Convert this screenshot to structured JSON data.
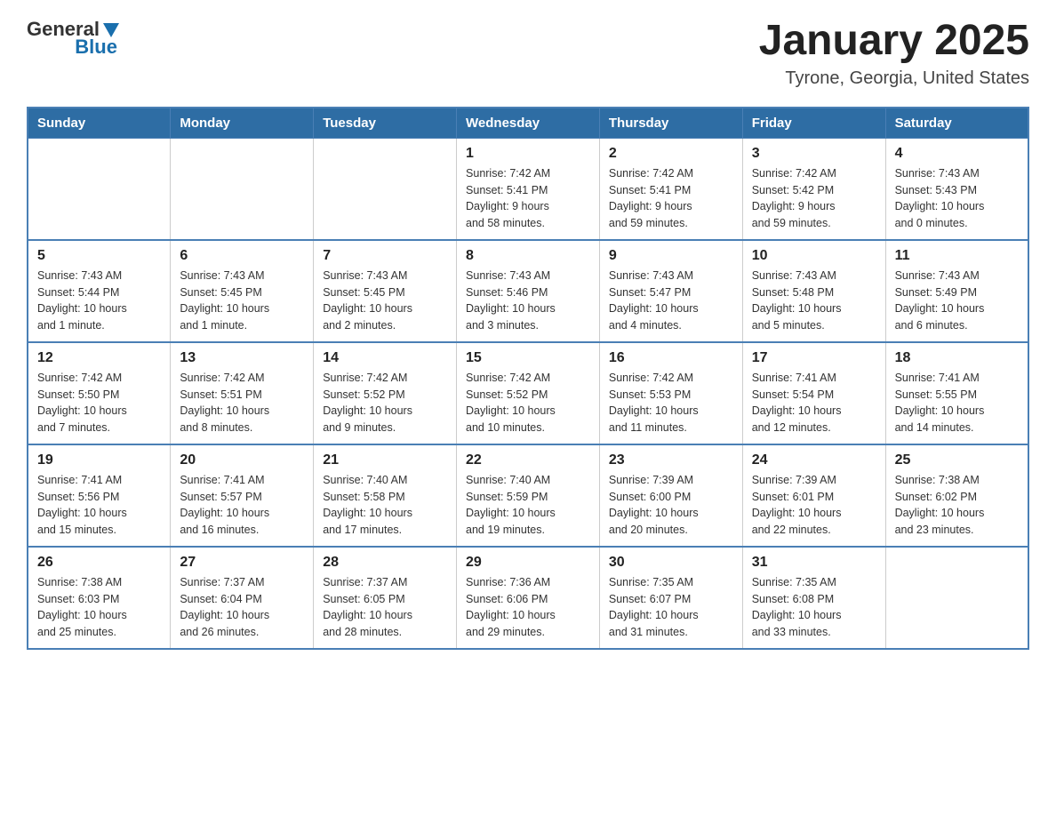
{
  "header": {
    "logo_general": "General",
    "logo_blue": "Blue",
    "title": "January 2025",
    "subtitle": "Tyrone, Georgia, United States"
  },
  "calendar": {
    "days_of_week": [
      "Sunday",
      "Monday",
      "Tuesday",
      "Wednesday",
      "Thursday",
      "Friday",
      "Saturday"
    ],
    "weeks": [
      [
        {
          "day": "",
          "info": ""
        },
        {
          "day": "",
          "info": ""
        },
        {
          "day": "",
          "info": ""
        },
        {
          "day": "1",
          "info": "Sunrise: 7:42 AM\nSunset: 5:41 PM\nDaylight: 9 hours\nand 58 minutes."
        },
        {
          "day": "2",
          "info": "Sunrise: 7:42 AM\nSunset: 5:41 PM\nDaylight: 9 hours\nand 59 minutes."
        },
        {
          "day": "3",
          "info": "Sunrise: 7:42 AM\nSunset: 5:42 PM\nDaylight: 9 hours\nand 59 minutes."
        },
        {
          "day": "4",
          "info": "Sunrise: 7:43 AM\nSunset: 5:43 PM\nDaylight: 10 hours\nand 0 minutes."
        }
      ],
      [
        {
          "day": "5",
          "info": "Sunrise: 7:43 AM\nSunset: 5:44 PM\nDaylight: 10 hours\nand 1 minute."
        },
        {
          "day": "6",
          "info": "Sunrise: 7:43 AM\nSunset: 5:45 PM\nDaylight: 10 hours\nand 1 minute."
        },
        {
          "day": "7",
          "info": "Sunrise: 7:43 AM\nSunset: 5:45 PM\nDaylight: 10 hours\nand 2 minutes."
        },
        {
          "day": "8",
          "info": "Sunrise: 7:43 AM\nSunset: 5:46 PM\nDaylight: 10 hours\nand 3 minutes."
        },
        {
          "day": "9",
          "info": "Sunrise: 7:43 AM\nSunset: 5:47 PM\nDaylight: 10 hours\nand 4 minutes."
        },
        {
          "day": "10",
          "info": "Sunrise: 7:43 AM\nSunset: 5:48 PM\nDaylight: 10 hours\nand 5 minutes."
        },
        {
          "day": "11",
          "info": "Sunrise: 7:43 AM\nSunset: 5:49 PM\nDaylight: 10 hours\nand 6 minutes."
        }
      ],
      [
        {
          "day": "12",
          "info": "Sunrise: 7:42 AM\nSunset: 5:50 PM\nDaylight: 10 hours\nand 7 minutes."
        },
        {
          "day": "13",
          "info": "Sunrise: 7:42 AM\nSunset: 5:51 PM\nDaylight: 10 hours\nand 8 minutes."
        },
        {
          "day": "14",
          "info": "Sunrise: 7:42 AM\nSunset: 5:52 PM\nDaylight: 10 hours\nand 9 minutes."
        },
        {
          "day": "15",
          "info": "Sunrise: 7:42 AM\nSunset: 5:52 PM\nDaylight: 10 hours\nand 10 minutes."
        },
        {
          "day": "16",
          "info": "Sunrise: 7:42 AM\nSunset: 5:53 PM\nDaylight: 10 hours\nand 11 minutes."
        },
        {
          "day": "17",
          "info": "Sunrise: 7:41 AM\nSunset: 5:54 PM\nDaylight: 10 hours\nand 12 minutes."
        },
        {
          "day": "18",
          "info": "Sunrise: 7:41 AM\nSunset: 5:55 PM\nDaylight: 10 hours\nand 14 minutes."
        }
      ],
      [
        {
          "day": "19",
          "info": "Sunrise: 7:41 AM\nSunset: 5:56 PM\nDaylight: 10 hours\nand 15 minutes."
        },
        {
          "day": "20",
          "info": "Sunrise: 7:41 AM\nSunset: 5:57 PM\nDaylight: 10 hours\nand 16 minutes."
        },
        {
          "day": "21",
          "info": "Sunrise: 7:40 AM\nSunset: 5:58 PM\nDaylight: 10 hours\nand 17 minutes."
        },
        {
          "day": "22",
          "info": "Sunrise: 7:40 AM\nSunset: 5:59 PM\nDaylight: 10 hours\nand 19 minutes."
        },
        {
          "day": "23",
          "info": "Sunrise: 7:39 AM\nSunset: 6:00 PM\nDaylight: 10 hours\nand 20 minutes."
        },
        {
          "day": "24",
          "info": "Sunrise: 7:39 AM\nSunset: 6:01 PM\nDaylight: 10 hours\nand 22 minutes."
        },
        {
          "day": "25",
          "info": "Sunrise: 7:38 AM\nSunset: 6:02 PM\nDaylight: 10 hours\nand 23 minutes."
        }
      ],
      [
        {
          "day": "26",
          "info": "Sunrise: 7:38 AM\nSunset: 6:03 PM\nDaylight: 10 hours\nand 25 minutes."
        },
        {
          "day": "27",
          "info": "Sunrise: 7:37 AM\nSunset: 6:04 PM\nDaylight: 10 hours\nand 26 minutes."
        },
        {
          "day": "28",
          "info": "Sunrise: 7:37 AM\nSunset: 6:05 PM\nDaylight: 10 hours\nand 28 minutes."
        },
        {
          "day": "29",
          "info": "Sunrise: 7:36 AM\nSunset: 6:06 PM\nDaylight: 10 hours\nand 29 minutes."
        },
        {
          "day": "30",
          "info": "Sunrise: 7:35 AM\nSunset: 6:07 PM\nDaylight: 10 hours\nand 31 minutes."
        },
        {
          "day": "31",
          "info": "Sunrise: 7:35 AM\nSunset: 6:08 PM\nDaylight: 10 hours\nand 33 minutes."
        },
        {
          "day": "",
          "info": ""
        }
      ]
    ]
  }
}
